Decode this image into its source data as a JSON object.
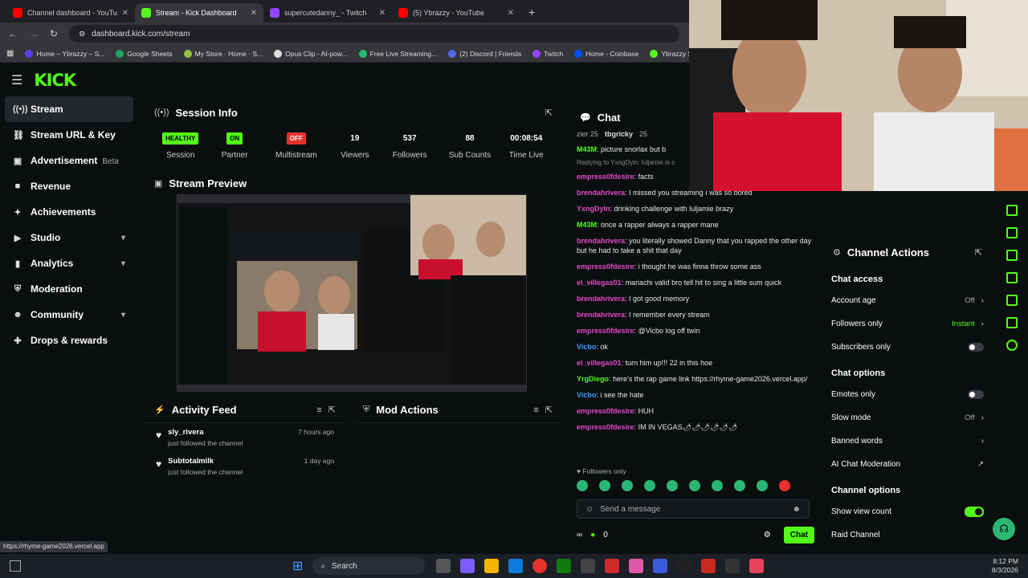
{
  "browser": {
    "tabs": [
      {
        "title": "Channel dashboard - YouTube",
        "color": "#ff0000",
        "active": false
      },
      {
        "title": "Stream - Kick Dashboard",
        "color": "#53fc18",
        "active": true
      },
      {
        "title": "supercutedanny_ - Twitch",
        "color": "#9146ff",
        "active": false
      },
      {
        "title": "(5) Ybrazzy - YouTube",
        "color": "#ff0000",
        "active": false
      }
    ],
    "new_tab": "+",
    "url": "dashboard.kick.com/stream",
    "bookmarks": [
      {
        "label": "Home – Ybrazzy – S...",
        "color": "#5b3df5"
      },
      {
        "label": "Google Sheets",
        "color": "#21a464"
      },
      {
        "label": "My Store · Home · S...",
        "color": "#95bf47"
      },
      {
        "label": "Opus Clip - AI-pow...",
        "color": "#dddddd"
      },
      {
        "label": "Free Live Streaming...",
        "color": "#2bb673"
      },
      {
        "label": "(2) Discord | Friends",
        "color": "#5865f2"
      },
      {
        "label": "Twitch",
        "color": "#9146ff"
      },
      {
        "label": "Home - Coinbase",
        "color": "#0052ff"
      },
      {
        "label": "Ybrazzy Stream - W...",
        "color": "#53fc18"
      }
    ],
    "status_url": "https://rhyme-game2026.vercel.app"
  },
  "brand": {
    "logo": "KICK",
    "accent": "#53fc18"
  },
  "sidebar": {
    "items": [
      {
        "label": "Stream",
        "icon": "broadcast-icon",
        "glyph": "((•))",
        "active": true
      },
      {
        "label": "Stream URL & Key",
        "icon": "link-icon",
        "glyph": "⛓"
      },
      {
        "label": "Advertisement",
        "icon": "megaphone-icon",
        "glyph": "▣",
        "badge": "Beta"
      },
      {
        "label": "Revenue",
        "icon": "dollar-icon",
        "glyph": "■"
      },
      {
        "label": "Achievements",
        "icon": "trophy-icon",
        "glyph": "✦"
      },
      {
        "label": "Studio",
        "icon": "video-icon",
        "glyph": "▶",
        "chevron": true
      },
      {
        "label": "Analytics",
        "icon": "chart-icon",
        "glyph": "▮",
        "chevron": true
      },
      {
        "label": "Moderation",
        "icon": "shield-icon",
        "glyph": "⛨"
      },
      {
        "label": "Community",
        "icon": "people-icon",
        "glyph": "☻",
        "chevron": true
      },
      {
        "label": "Drops & rewards",
        "icon": "gift-icon",
        "glyph": "✚"
      }
    ]
  },
  "session": {
    "title": "Session Info",
    "stats": [
      {
        "value": "HEALTHY",
        "label": "Session",
        "badge_color": "#53fc18",
        "text_color": "#000"
      },
      {
        "value": "ON",
        "label": "Partner",
        "badge_color": "#53fc18",
        "text_color": "#000"
      },
      {
        "value": "OFF",
        "label": "Multistream",
        "badge_color": "#e5322d",
        "text_color": "#fff"
      },
      {
        "value": "19",
        "label": "Viewers"
      },
      {
        "value": "537",
        "label": "Followers"
      },
      {
        "value": "88",
        "label": "Sub Counts"
      },
      {
        "value": "00:08:54",
        "label": "Time Live"
      }
    ]
  },
  "preview": {
    "title": "Stream Preview"
  },
  "activity": {
    "title": "Activity Feed",
    "items": [
      {
        "name": "sly_rivera",
        "action": "just followed the channel",
        "time": "7 hours ago"
      },
      {
        "name": "Subtotalmilk",
        "action": "just followed the channel",
        "time": "1 day ago"
      }
    ]
  },
  "mod_actions": {
    "title": "Mod Actions"
  },
  "chat": {
    "title": "Chat",
    "top": [
      {
        "user": "tbgricky",
        "num": "25"
      }
    ],
    "messages": [
      {
        "user": "M43M",
        "text": "picture snorlax but b",
        "cls": "yg"
      },
      {
        "user": "",
        "text": "Replying to YxngDyln: luljamie is c",
        "cls": "reply"
      },
      {
        "user": "empress0fdesire",
        "text": "facts",
        "cls": "pm"
      },
      {
        "user": "brendahrivera",
        "text": "I missed you streaming I was so bored",
        "cls": "pm"
      },
      {
        "user": "YxngDyln",
        "text": "drinking challenge with luljamie brazy",
        "cls": "pm"
      },
      {
        "user": "M43M",
        "text": "once a rapper always a rapper mane",
        "cls": "yg"
      },
      {
        "user": "brendahrivera",
        "text": "you literally showed Danny that you rapped the other day but he had to take a shit that day",
        "cls": "pm"
      },
      {
        "user": "empress0fdesire",
        "text": "i thought he was finna throw some ass",
        "cls": "pm"
      },
      {
        "user": "el_villegas01",
        "text": "mariachi valid bro tell hit to sing a little sum quick",
        "cls": "pm"
      },
      {
        "user": "brendahrivera",
        "text": "I got good memory",
        "cls": "pm"
      },
      {
        "user": "brendahrivera",
        "text": "I remember every stream",
        "cls": "pm"
      },
      {
        "user": "empress0fdesire",
        "text": "@Vicbo log off twin",
        "cls": "pm"
      },
      {
        "user": "Vicbo",
        "text": "ok",
        "cls": "bl"
      },
      {
        "user": "el_villegas01",
        "text": "turn him up!!! 22 in this hoe",
        "cls": "pm"
      },
      {
        "user": "YrgDiego",
        "text": "here's the rap game link https://rhyme-game2026.vercel.app/",
        "cls": "gr"
      },
      {
        "user": "Vicbo",
        "text": "i see the hate",
        "cls": "bl"
      },
      {
        "user": "empress0fdesire",
        "text": "HUH",
        "cls": "pm"
      },
      {
        "user": "empress0fdesire",
        "text": "IM IN VEGAS🌶🌶🌶🌶🌶🌶",
        "cls": "pm"
      }
    ],
    "followers_only": "Followers only",
    "placeholder": "Send a message",
    "points": "0",
    "send_label": "Chat"
  },
  "channel_actions": {
    "title": "Channel Actions",
    "sections": [
      {
        "heading": "Chat access",
        "rows": [
          {
            "label": "Account age",
            "value": "Off",
            "kind": "chevron"
          },
          {
            "label": "Followers only",
            "value": "Instant",
            "kind": "chevron",
            "green": true
          },
          {
            "label": "Subscribers only",
            "kind": "toggle"
          }
        ]
      },
      {
        "heading": "Chat options",
        "rows": [
          {
            "label": "Emotes only",
            "kind": "toggle"
          },
          {
            "label": "Slow mode",
            "value": "Off",
            "kind": "chevron"
          },
          {
            "label": "Banned words",
            "kind": "chevron"
          },
          {
            "label": "AI Chat Moderation",
            "kind": "external"
          }
        ]
      },
      {
        "heading": "Channel options",
        "rows": [
          {
            "label": "Show view count",
            "kind": "toggle-on"
          },
          {
            "label": "Raid Channel",
            "kind": "none"
          }
        ]
      }
    ]
  },
  "taskbar": {
    "search_label": "Search",
    "time": "8:12 PM",
    "date": "8/3/2026"
  }
}
